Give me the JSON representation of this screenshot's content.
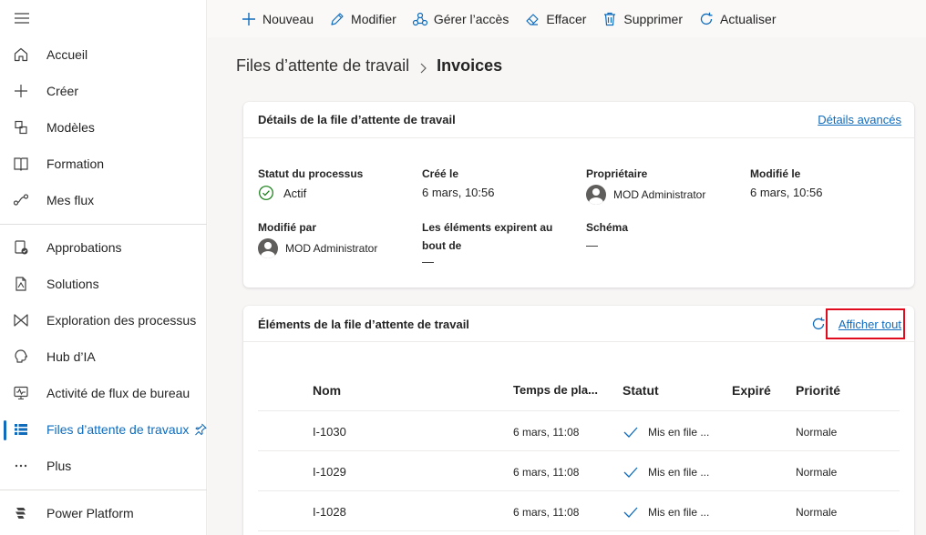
{
  "sidebar": {
    "items": [
      {
        "label": "Accueil",
        "icon": "home-icon"
      },
      {
        "label": "Créer",
        "icon": "plus-icon"
      },
      {
        "label": "Modèles",
        "icon": "templates-icon"
      },
      {
        "label": "Formation",
        "icon": "book-icon"
      },
      {
        "label": "Mes flux",
        "icon": "flow-icon"
      },
      {
        "label": "Approbations",
        "icon": "approvals-icon"
      },
      {
        "label": "Solutions",
        "icon": "solutions-icon"
      },
      {
        "label": "Exploration des processus",
        "icon": "process-mining-icon"
      },
      {
        "label": "Hub d’IA",
        "icon": "ai-hub-icon"
      },
      {
        "label": "Activité de flux de bureau",
        "icon": "desktop-activity-icon"
      },
      {
        "label": "Files d’attente de travaux",
        "icon": "work-queues-icon"
      },
      {
        "label": "Plus",
        "icon": "more-icon"
      },
      {
        "label": "Power Platform",
        "icon": "power-platform-icon"
      }
    ]
  },
  "toolbar": {
    "new": "Nouveau",
    "edit": "Modifier",
    "manage_access": "Gérer l’accès",
    "clear": "Effacer",
    "delete": "Supprimer",
    "refresh": "Actualiser"
  },
  "breadcrumb": {
    "parent": "Files d’attente de travail",
    "current": "Invoices"
  },
  "details": {
    "title": "Détails de la file d’attente de travail",
    "advanced_link": "Détails avancés",
    "process_status_label": "Statut du processus",
    "process_status_value": "Actif",
    "created_label": "Créé le",
    "created_value": "6 mars, 10:56",
    "owner_label": "Propriétaire",
    "owner_value": "MOD Administrator",
    "modified_label": "Modifié le",
    "modified_value": "6 mars, 10:56",
    "modified_by_label": "Modifié par",
    "modified_by_value": "MOD Administrator",
    "expire_label_1": "Les éléments expirent au",
    "expire_label_2": "bout de",
    "expire_value": "—",
    "schema_label": "Schéma",
    "schema_value": "—"
  },
  "items": {
    "title": "Éléments de la file d’attente de travail",
    "show_all": "Afficher tout",
    "columns": {
      "name": "Nom",
      "time": "Temps de pla...",
      "status": "Statut",
      "expired": "Expiré",
      "priority": "Priorité"
    },
    "rows": [
      {
        "name": "I-1030",
        "time": "6 mars, 11:08",
        "status": "Mis en file ...",
        "expired": "",
        "priority": "Normale"
      },
      {
        "name": "I-1029",
        "time": "6 mars, 11:08",
        "status": "Mis en file ...",
        "expired": "",
        "priority": "Normale"
      },
      {
        "name": "I-1028",
        "time": "6 mars, 11:08",
        "status": "Mis en file ...",
        "expired": "",
        "priority": "Normale"
      }
    ]
  },
  "colors": {
    "accent": "#0f6cbd",
    "success": "#107c10",
    "highlight": "#e00b1c"
  }
}
